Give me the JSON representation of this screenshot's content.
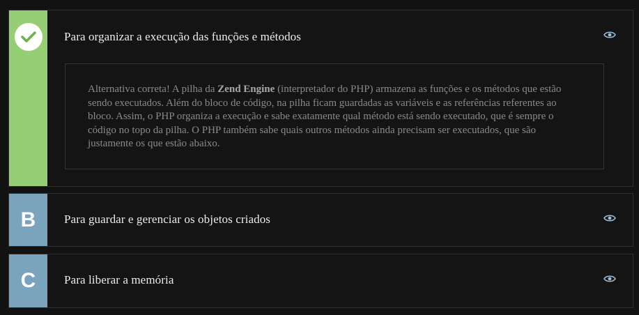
{
  "alternatives": [
    {
      "label": "Para organizar a execução das funções e métodos",
      "status": "correct",
      "explanation": {
        "before": "Alternativa correta! A pilha da ",
        "bold": "Zend Engine",
        "after": " (interpretador do PHP) armazena as funções e os métodos que estão sendo executados. Além do bloco de código, na pilha ficam guardadas as variáveis e as referências referentes ao bloco. Assim, o PHP organiza a execução e sabe exatamente qual método está sendo executado, que é sempre o código no topo da pilha. O PHP também sabe quais outros métodos ainda precisam ser executados, que são justamente os que estão abaixo."
      }
    },
    {
      "letter": "B",
      "label": "Para guardar e gerenciar os objetos criados"
    },
    {
      "letter": "C",
      "label": "Para liberar a memória"
    }
  ],
  "icons": {
    "correct_marker": "check-icon",
    "reveal": "eye-icon"
  },
  "colors": {
    "correct": "#95ce74",
    "letter_marker": "#7aa3bd",
    "eye_icon": "#9bbfd8"
  }
}
